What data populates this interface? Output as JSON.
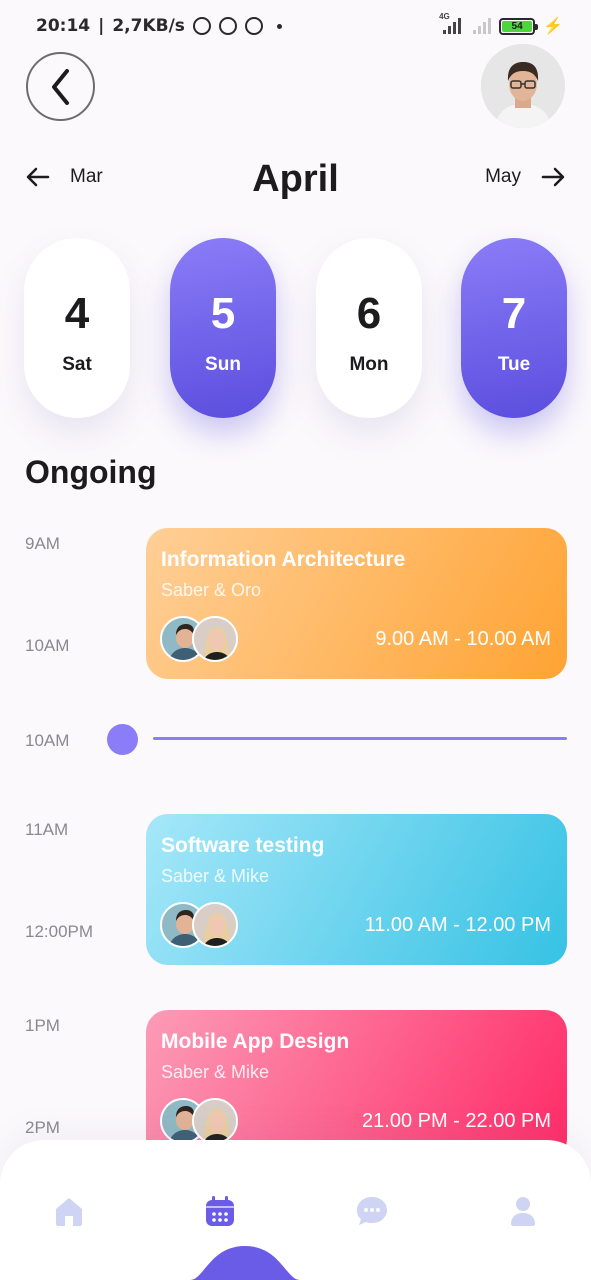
{
  "status_bar": {
    "time": "20:14",
    "speed": "2,7KB/s",
    "network_type": "4G",
    "battery_level": "54"
  },
  "header": {
    "back_icon": "chevron-left-icon",
    "avatar_icon": "user-avatar"
  },
  "months": {
    "previous": "Mar",
    "current": "April",
    "next": "May"
  },
  "days": [
    {
      "num": "4",
      "name": "Sat",
      "active": false
    },
    {
      "num": "5",
      "name": "Sun",
      "active": true
    },
    {
      "num": "6",
      "name": "Mon",
      "active": false
    },
    {
      "num": "7",
      "name": "Tue",
      "active": true
    }
  ],
  "section": {
    "title": "Ongoing"
  },
  "time_labels": [
    "9AM",
    "10AM",
    "10AM",
    "11AM",
    "12:00PM",
    "1PM",
    "2PM"
  ],
  "events": [
    {
      "title": "Information Architecture",
      "people": "Saber & Oro",
      "time": "9.00 AM - 10.00 AM",
      "color": "#ffa333"
    },
    {
      "title": "Software testing",
      "people": "Saber & Mike",
      "time": "11.00 AM - 12.00 PM",
      "color": "#36c2e4"
    },
    {
      "title": "Mobile App Design",
      "people": "Saber & Mike",
      "time": "21.00 PM - 22.00 PM",
      "color": "#ff2a66"
    }
  ],
  "nav": {
    "items": [
      "home-icon",
      "calendar-icon",
      "chat-icon",
      "profile-icon"
    ],
    "active": "calendar-icon"
  },
  "colors": {
    "accent": "#6b5ce7",
    "accent_light": "#8b7cf7",
    "text_primary": "#1c1c1e",
    "text_secondary": "#8a8a8e"
  }
}
